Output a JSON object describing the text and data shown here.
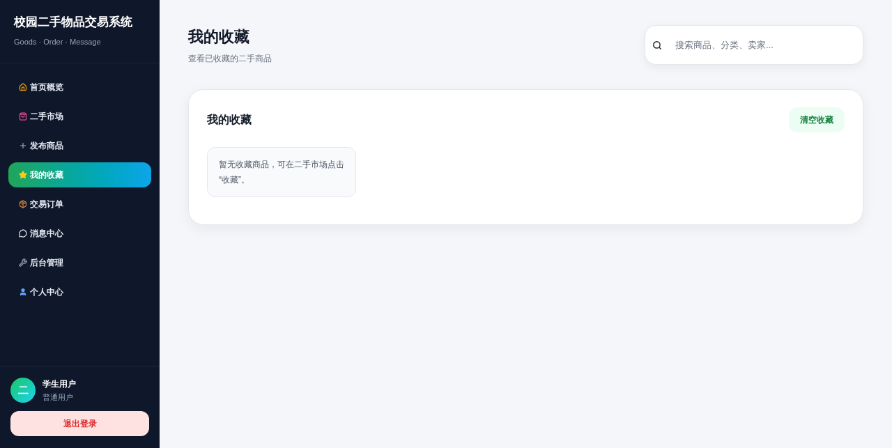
{
  "sidebar": {
    "title": "校园二手物品交易系统",
    "subtitle": "Goods · Order · Message",
    "nav": [
      {
        "label": "首页概览",
        "selected": false
      },
      {
        "label": "二手市场",
        "selected": false
      },
      {
        "label": "发布商品",
        "selected": false
      },
      {
        "label": "我的收藏",
        "selected": true
      },
      {
        "label": "交易订单",
        "selected": false
      },
      {
        "label": "消息中心",
        "selected": false
      },
      {
        "label": "后台管理",
        "selected": false
      },
      {
        "label": "个人中心",
        "selected": false
      }
    ],
    "user": {
      "avatar": "二",
      "name": "学生用户",
      "role": "普通用户"
    },
    "logout_button": "退出登录"
  },
  "header": {
    "title": "我的收藏",
    "subtitle": "查看已收藏的二手商品"
  },
  "search": {
    "placeholder": "搜索商品、分类、卖家..."
  },
  "favorites_card": {
    "title": "我的收藏",
    "clear_button": "清空收藏",
    "empty_message": "暂无收藏商品，可在二手市场点击“收藏”。"
  }
}
